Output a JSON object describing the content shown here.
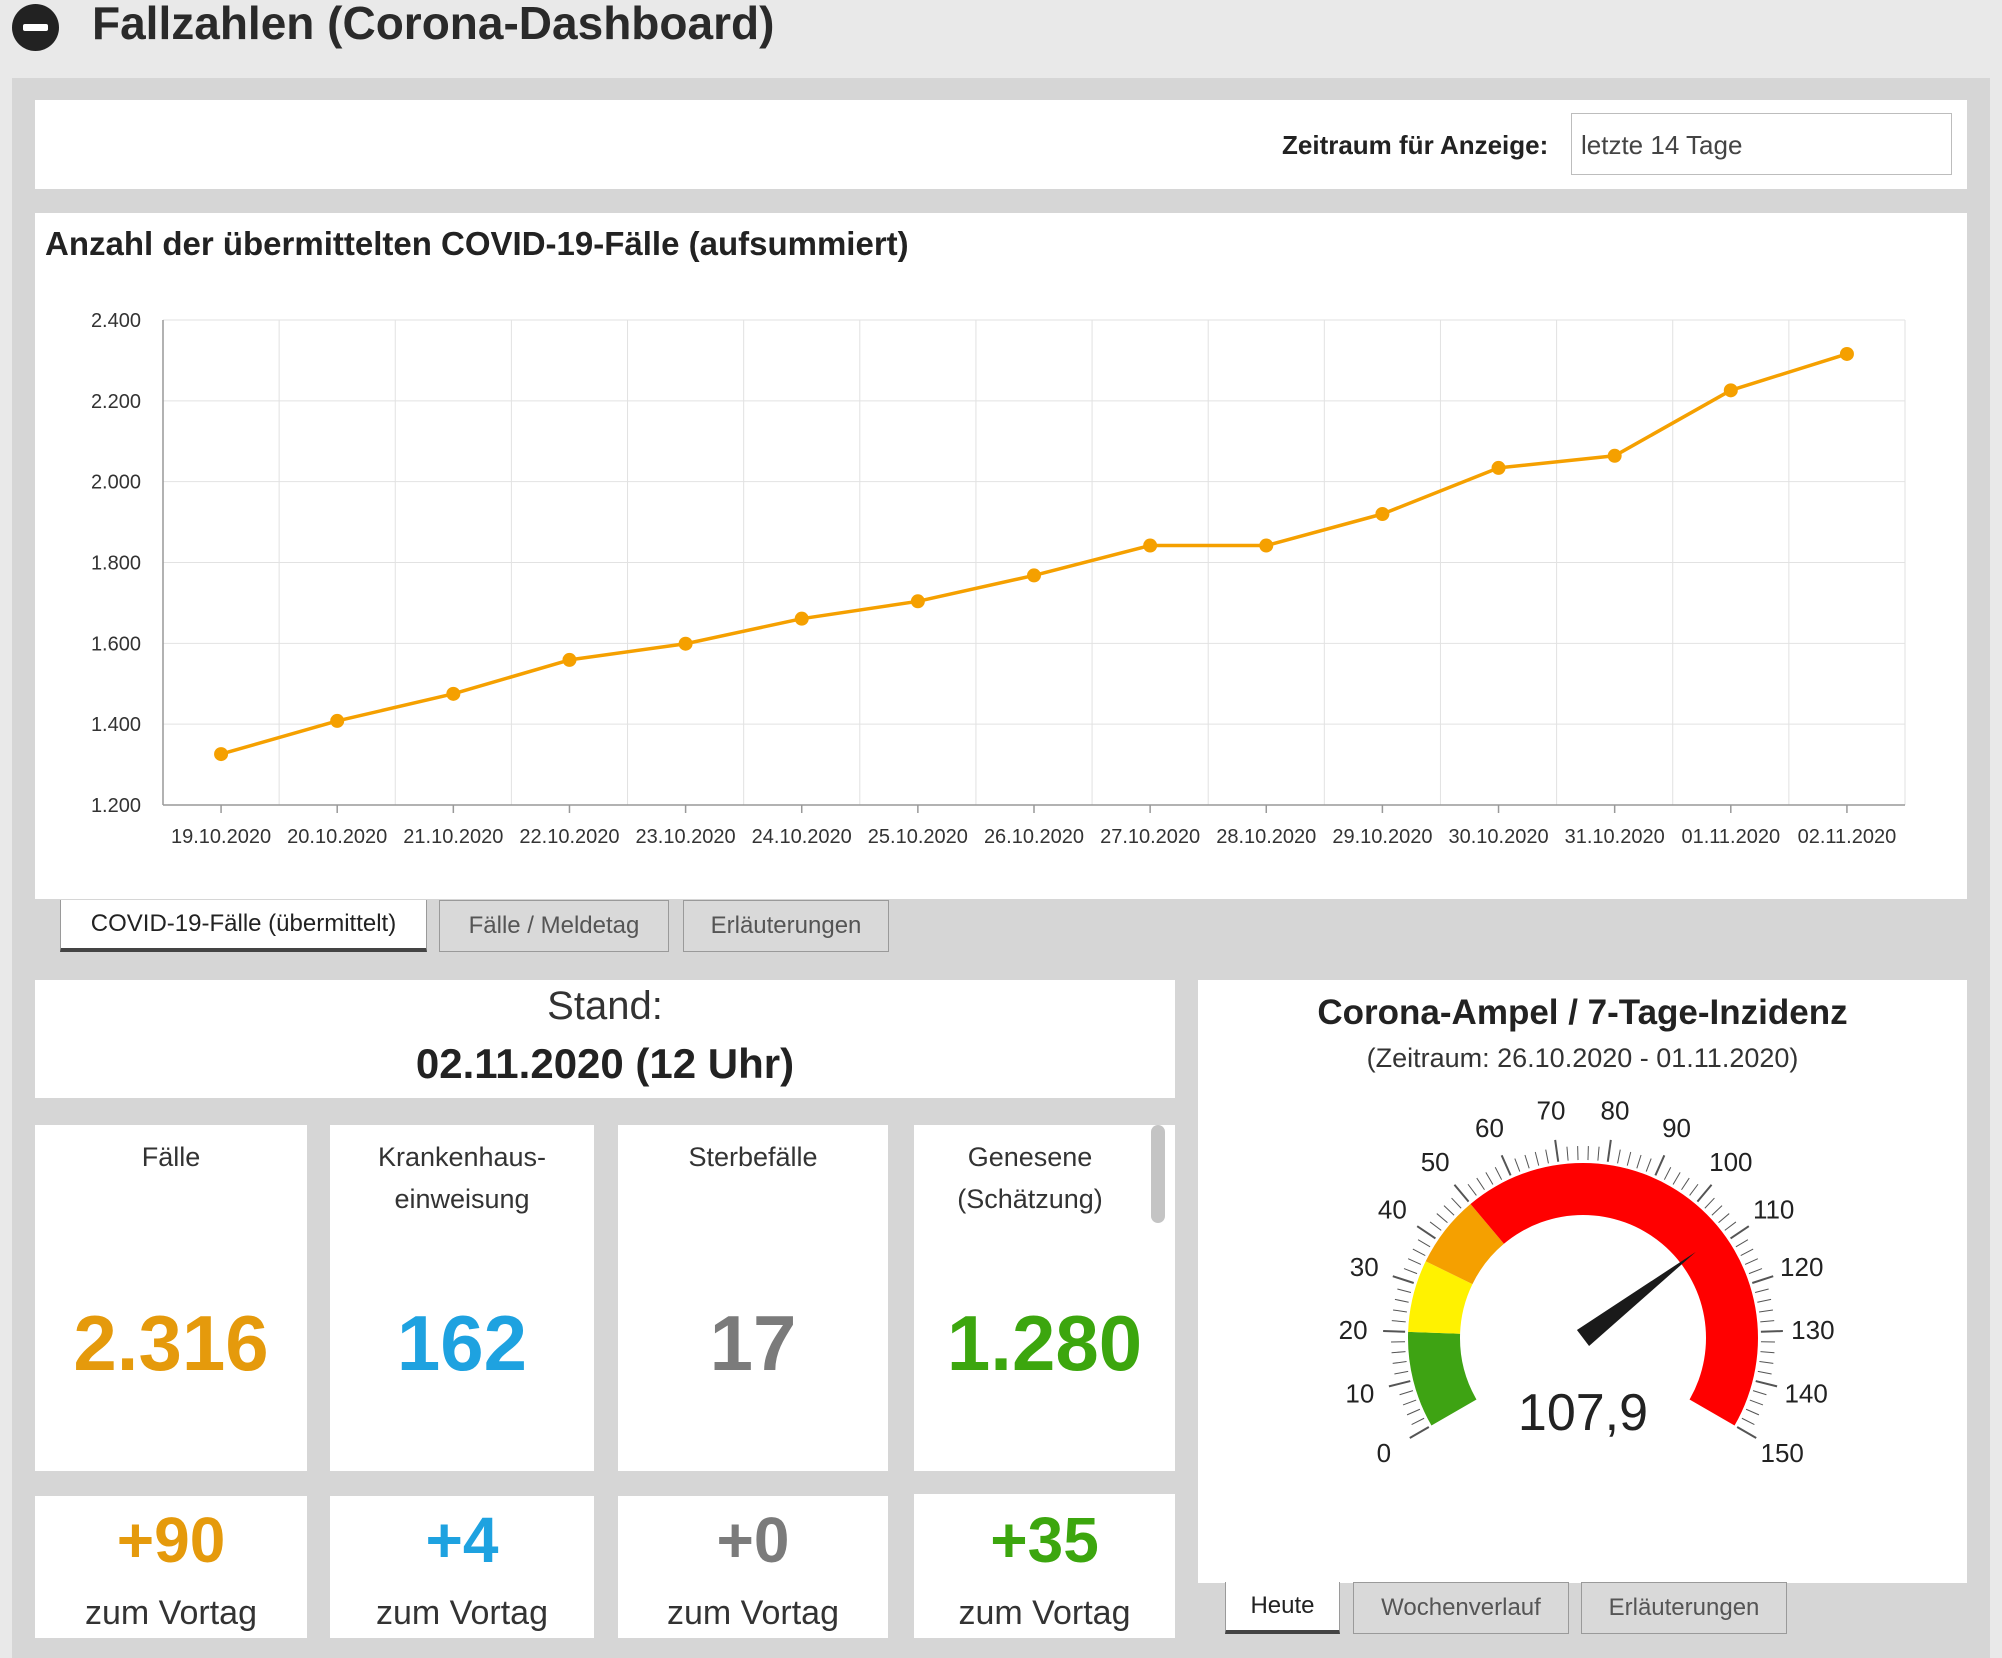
{
  "header": {
    "title": "Fallzahlen (Corona-Dashboard)",
    "collapse_icon": "minus-circle-icon"
  },
  "selector": {
    "label": "Zeitraum für Anzeige:",
    "value": "letzte 14 Tage",
    "icon": "chevron-down-icon"
  },
  "chart_data": {
    "type": "line",
    "title": "Anzahl der übermittelten COVID-19-Fälle (aufsummiert)",
    "xlabel": "",
    "ylabel": "",
    "categories": [
      "19.10.2020",
      "20.10.2020",
      "21.10.2020",
      "22.10.2020",
      "23.10.2020",
      "24.10.2020",
      "25.10.2020",
      "26.10.2020",
      "27.10.2020",
      "28.10.2020",
      "29.10.2020",
      "30.10.2020",
      "31.10.2020",
      "01.11.2020",
      "02.11.2020"
    ],
    "series": [
      {
        "values": [
          1326,
          1408,
          1475,
          1559,
          1599,
          1661,
          1704,
          1768,
          1842,
          1842,
          1920,
          2034,
          2064,
          2226,
          2316
        ]
      }
    ],
    "ylim": [
      1200,
      2400
    ],
    "yticks": [
      "1.200",
      "1.400",
      "1.600",
      "1.800",
      "2.000",
      "2.200",
      "2.400"
    ],
    "ytick_values": [
      1200,
      1400,
      1600,
      1800,
      2000,
      2200,
      2400
    ],
    "grid": true,
    "legend": "none",
    "color": "#f5a000"
  },
  "chart_tabs": [
    {
      "label": "COVID-19-Fälle (übermittelt)",
      "active": true
    },
    {
      "label": "Fälle / Meldetag",
      "active": false
    },
    {
      "label": "Erläuterungen",
      "active": false
    }
  ],
  "stand": {
    "label": "Stand:",
    "date": "02.11.2020 (12 Uhr)"
  },
  "kpis": [
    {
      "label_lines": [
        "Fälle"
      ],
      "value": "2.316",
      "delta": "+90",
      "delta_label": "zum Vortag",
      "color": "#e59a0c"
    },
    {
      "label_lines": [
        "Krankenhaus-",
        "einweisung"
      ],
      "value": "162",
      "delta": "+4",
      "delta_label": "zum Vortag",
      "color": "#1ea2e0"
    },
    {
      "label_lines": [
        "Sterbefälle"
      ],
      "value": "17",
      "delta": "+0",
      "delta_label": "zum Vortag",
      "color": "#7b7b7b"
    },
    {
      "label_lines": [
        "Genesene",
        "(Schätzung)"
      ],
      "value": "1.280",
      "delta": "+35",
      "delta_label": "zum Vortag",
      "color": "#3ca60e"
    }
  ],
  "gauge": {
    "title": "Corona-Ampel / 7-Tage-Inzidenz",
    "subtitle": "(Zeitraum: 26.10.2020 - 01.11.2020)",
    "value": 107.9,
    "value_label": "107,9",
    "min": 0,
    "max": 150,
    "tick_labels": [
      "0",
      "10",
      "20",
      "30",
      "40",
      "50",
      "60",
      "70",
      "80",
      "90",
      "100",
      "110",
      "120",
      "130",
      "140",
      "150"
    ],
    "bands": [
      {
        "from": 0,
        "to": 20,
        "color": "#3ea313"
      },
      {
        "from": 20,
        "to": 35,
        "color": "#fff200"
      },
      {
        "from": 35,
        "to": 50,
        "color": "#f5a000"
      },
      {
        "from": 50,
        "to": 150,
        "color": "#ff0000"
      }
    ]
  },
  "gauge_tabs": [
    {
      "label": "Heute",
      "active": true
    },
    {
      "label": "Wochenverlauf",
      "active": false
    },
    {
      "label": "Erläuterungen",
      "active": false
    }
  ]
}
